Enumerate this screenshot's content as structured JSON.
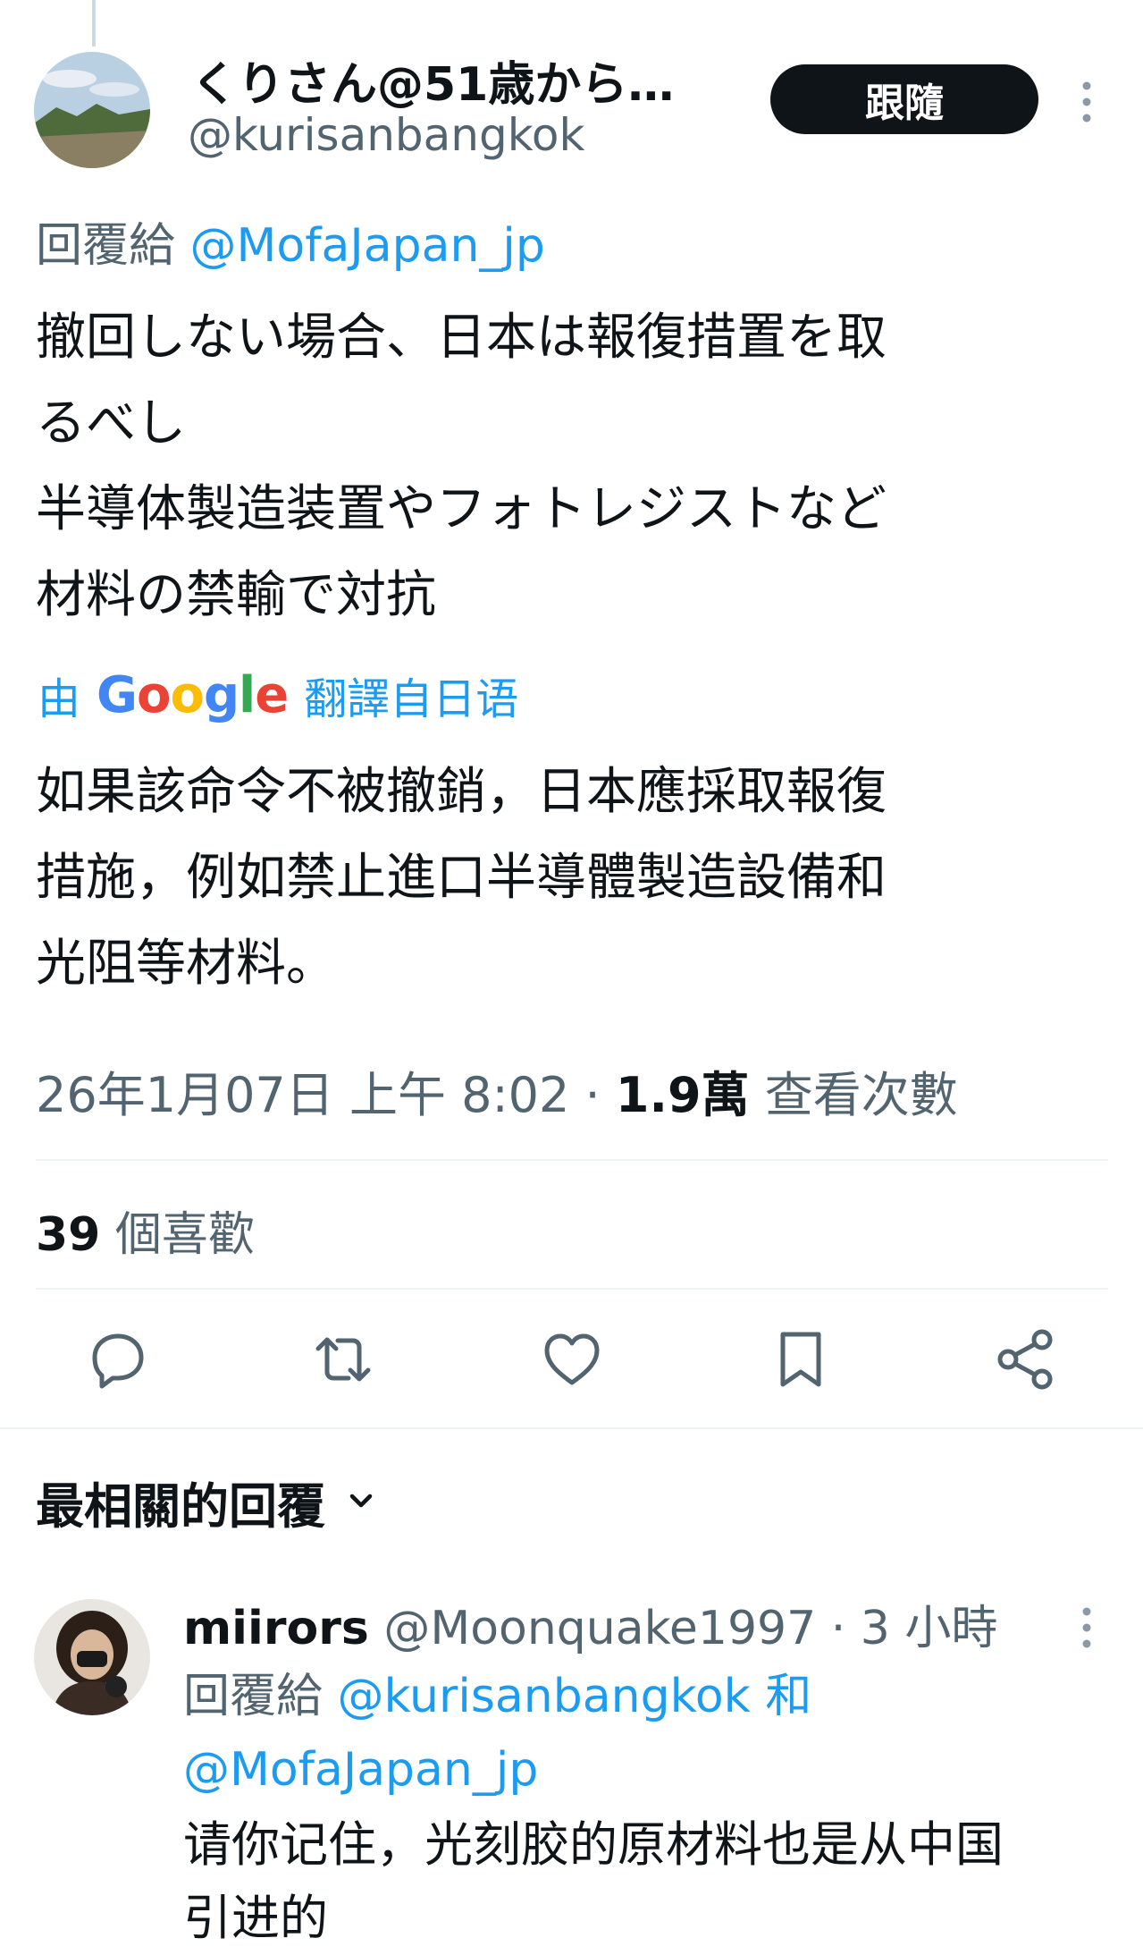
{
  "tweet": {
    "author_name": "くりさん@51歳から…",
    "author_handle": "@kurisanbangkok",
    "follow_label": "跟隨",
    "reply_to_prefix": "回覆給",
    "reply_to_handle": "@MofaJapan_jp",
    "text": "撤回しない場合、日本は報復措置を取\nるべし\n半導体製造装置やフォトレジストなど\n材料の禁輸で対抗",
    "translation_by": "由",
    "translation_brand": "Google",
    "translation_suffix": "翻譯自日语",
    "translated_text": "如果該命令不被撤銷，日本應採取報復\n措施，例如禁止進口半導體製造設備和\n光阻等材料。",
    "timestamp": "26年1月07日 上午 8:02",
    "dot": "·",
    "views_count": "1.9萬",
    "views_label": "查看次數",
    "likes_count": "39",
    "likes_label": "個喜歡"
  },
  "actions": [
    "reply-icon",
    "retweet-icon",
    "like-icon",
    "bookmark-icon",
    "share-icon"
  ],
  "relevant_replies": {
    "label": "最相關的回覆"
  },
  "reply": {
    "author_name": "miirors",
    "author_handle": "@Moonquake1997",
    "dot": "·",
    "time": "3 小時",
    "reply_to_prefix": "回覆給",
    "reply_to_handle1": "@kurisanbangkok",
    "reply_to_and": "和",
    "reply_to_handle2": "@MofaJapan_jp",
    "text": "请你记住，光刻胶的原材料也是从中国\n引进的"
  },
  "colors": {
    "accent": "#1d9bf0",
    "secondary_text": "#536471",
    "divider": "#eff3f4"
  }
}
